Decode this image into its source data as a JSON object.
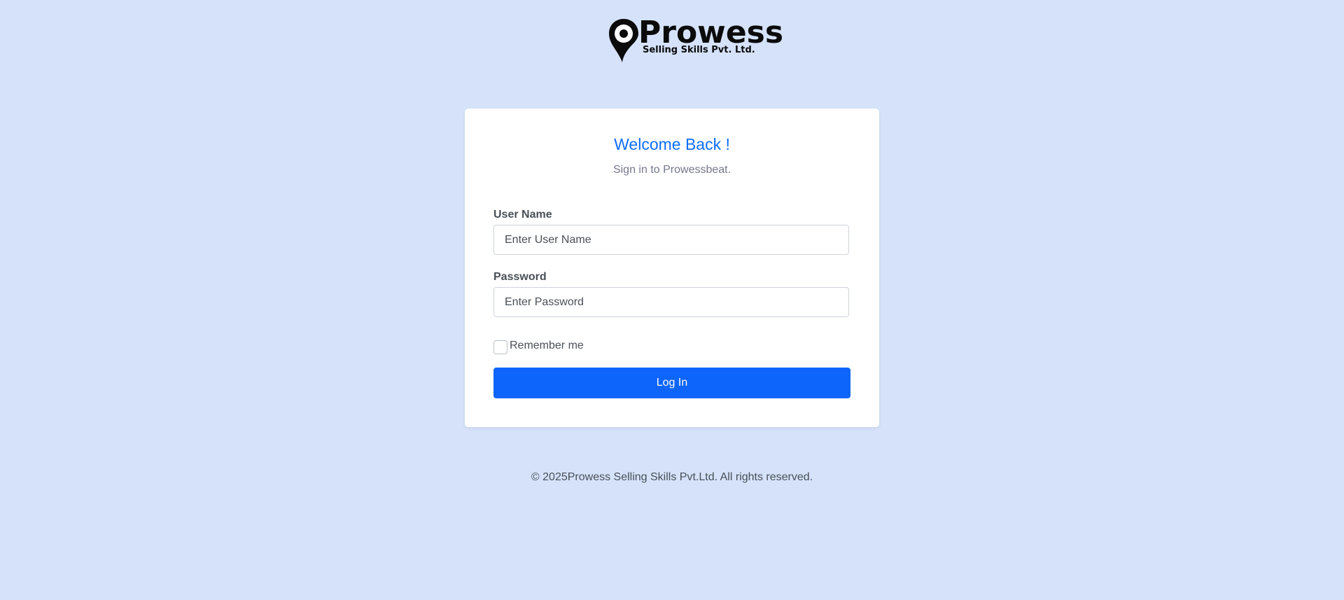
{
  "brand": {
    "logo_word": "Prowess",
    "logo_tagline": "Selling Skills Pvt. Ltd.",
    "text_color": "#0b0b0b"
  },
  "login": {
    "title": "Welcome Back !",
    "subtitle": "Sign in to Prowessbeat.",
    "username_label": "User Name",
    "username_placeholder": "Enter User Name",
    "username_value": "",
    "password_label": "Password",
    "password_placeholder": "Enter Password",
    "password_value": "",
    "remember_label": "Remember me",
    "remember_checked": false,
    "submit_label": "Log In"
  },
  "footer": {
    "copyright": "© 2025Prowess Selling Skills Pvt.Ltd. All rights reserved."
  },
  "colors": {
    "background": "#d5e2fa",
    "accent": "#0d6efd",
    "button": "#0d65fb"
  }
}
